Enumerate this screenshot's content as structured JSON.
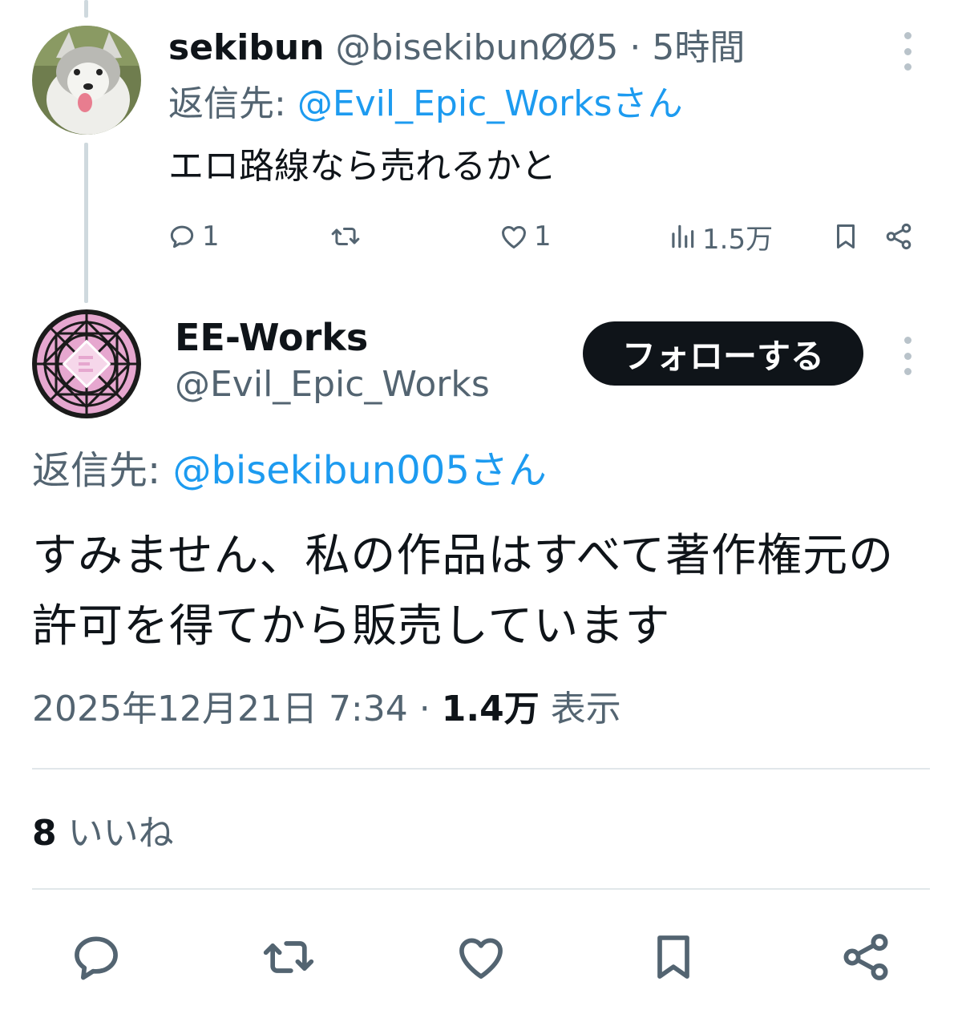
{
  "reply_tweet": {
    "display_name": "sekibun",
    "handle": "@bisekibunØØ5",
    "separator": "·",
    "time": "5時間",
    "replying_label": "返信先:",
    "replying_mention": "@Evil_Epic_Worksさん",
    "text": "エロ路線なら売れるかと",
    "actions": {
      "reply_count": "1",
      "retweet_count": "",
      "like_count": "1",
      "views_count": "1.5万"
    }
  },
  "main_tweet": {
    "display_name": "EE-Works",
    "handle": "@Evil_Epic_Works",
    "follow_label": "フォローする",
    "replying_label": "返信先:",
    "replying_mention": "@bisekibun005さん",
    "text": "すみません、私の作品はすべて著作権元の許可を得てから販売しています",
    "timestamp": "2025年12月21日 7:34",
    "separator": "·",
    "views_count": "1.4万",
    "views_label": "表示",
    "likes_count": "8",
    "likes_label": "いいね"
  },
  "colors": {
    "accent": "#1d9bf0",
    "text_primary": "#0f1419",
    "text_secondary": "#536471",
    "divider": "#e1e7ea",
    "thread_line": "#cfd9de",
    "follow_button": "#0f1419"
  },
  "icons": [
    "reply-icon",
    "retweet-icon",
    "like-icon",
    "views-icon",
    "bookmark-icon",
    "share-icon",
    "more-icon"
  ]
}
